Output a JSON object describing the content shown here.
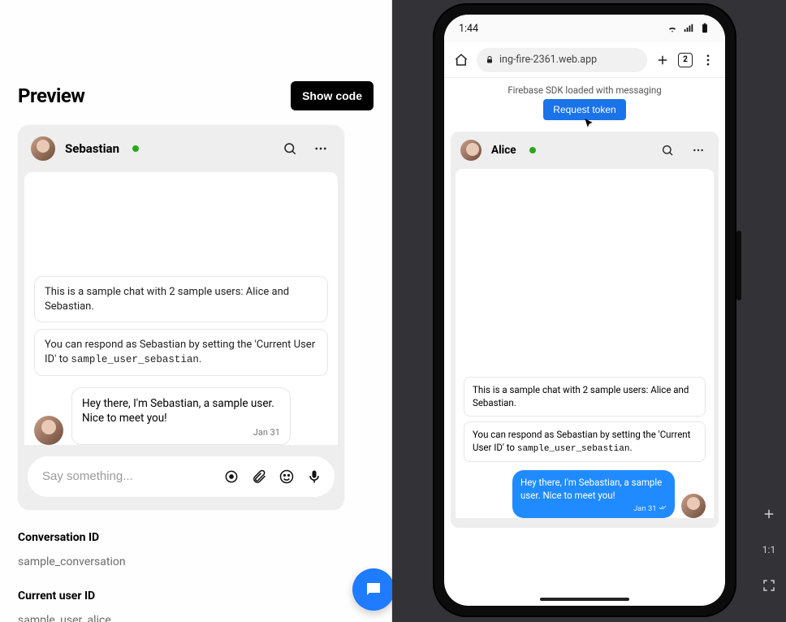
{
  "left": {
    "title": "Preview",
    "show_code_label": "Show code",
    "chat": {
      "header_name": "Sebastian",
      "sys1": "This is a sample chat with 2 sample users: Alice and Sebastian.",
      "sys2_prefix": "You can respond as Sebastian by setting the 'Current User ID' to ",
      "sys2_code": "sample_user_sebastian",
      "sys2_suffix": ".",
      "msg_text": "Hey there, I'm Sebastian, a sample user. Nice to meet you!",
      "msg_date": "Jan 31",
      "composer_placeholder": "Say something..."
    },
    "fields": {
      "conversation_id_label": "Conversation ID",
      "conversation_id_value": "sample_conversation",
      "current_user_label": "Current user ID",
      "current_user_value": "sample_user_alice"
    }
  },
  "phone": {
    "status_time": "1:44",
    "url": "ing-fire-2361.web.app",
    "tab_count": "2",
    "sdk_line": "Firebase SDK loaded with messaging",
    "request_token_label": "Request token",
    "chat": {
      "header_name": "Alice",
      "sys1": "This is a sample chat with 2 sample users: Alice and Sebastian.",
      "sys2_prefix": "You can respond as Sebastian by setting the 'Current User ID' to ",
      "sys2_code": "sample_user_sebastian",
      "sys2_suffix": ".",
      "msg_text": "Hey there, I'm Sebastian, a sample user. Nice to meet you!",
      "msg_date": "Jan 31"
    }
  },
  "right_tools": {
    "ratio_label": "1:1"
  }
}
